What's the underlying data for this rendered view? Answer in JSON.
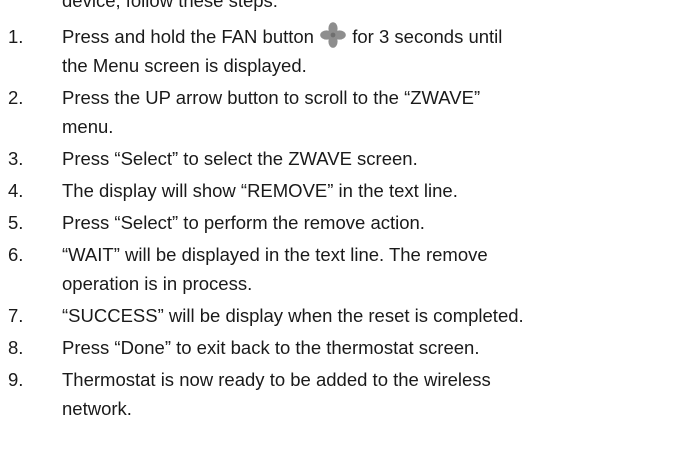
{
  "top_fragment": "device, follow these steps:",
  "fan_icon": "fan-icon",
  "steps": [
    {
      "num": "1.",
      "lines": [
        "Press and hold the FAN button",
        "for 3 seconds until",
        "the Menu screen is displayed."
      ]
    },
    {
      "num": "2.",
      "lines": [
        "Press the UP arrow button to scroll to the “ZWAVE”",
        "menu."
      ]
    },
    {
      "num": "3.",
      "lines": [
        "Press “Select” to select the ZWAVE screen."
      ]
    },
    {
      "num": "4.",
      "lines": [
        "The display will show “REMOVE” in the text line."
      ]
    },
    {
      "num": "5.",
      "lines": [
        "Press “Select” to perform the remove action."
      ]
    },
    {
      "num": "6.",
      "lines": [
        "“WAIT” will be displayed in the text line.  The remove",
        "operation is in process."
      ]
    },
    {
      "num": "7.",
      "lines": [
        "“SUCCESS” will be display when the reset is completed."
      ]
    },
    {
      "num": "8.",
      "lines": [
        "Press “Done” to exit back to the thermostat screen."
      ]
    },
    {
      "num": "9.",
      "lines": [
        "Thermostat is now ready to be added to the wireless",
        "network."
      ]
    }
  ]
}
